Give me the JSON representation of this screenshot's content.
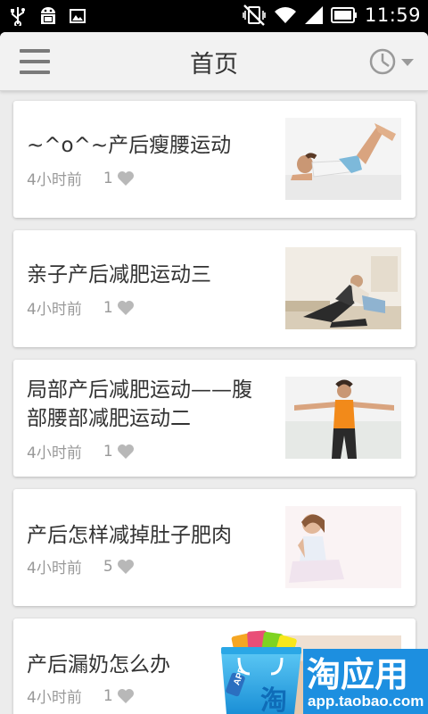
{
  "status_bar": {
    "time": "11:59",
    "left_icons": [
      "usb-icon",
      "android-debug-icon",
      "image-icon"
    ],
    "right_icons": [
      "vibrate-off-icon",
      "wifi-icon",
      "signal-icon",
      "battery-icon"
    ]
  },
  "app_bar": {
    "title": "首页",
    "menu_icon": "hamburger-menu-icon",
    "history_icon": "clock-dropdown-icon"
  },
  "articles": [
    {
      "title": "~^o^~产后瘦腰运动",
      "time": "4小时前",
      "likes": "1",
      "image": "woman-lying-leg-raise"
    },
    {
      "title": "亲子产后减肥运动三",
      "time": "4小时前",
      "likes": "1",
      "image": "mother-child-exercise"
    },
    {
      "title": "局部产后减肥运动——腹部腰部减肥运动二",
      "time": "4小时前",
      "likes": "1",
      "image": "woman-arms-stretch"
    },
    {
      "title": "产后怎样减掉肚子肥肉",
      "time": "4小时前",
      "likes": "5",
      "image": "woman-sitting-yoga"
    },
    {
      "title": "产后漏奶怎么办",
      "time": "4小时前",
      "likes": "1",
      "image": "mother-with-baby"
    }
  ],
  "promo": {
    "name": "淘应用",
    "url": "app.taobao.com",
    "badge": "APP",
    "glyph": "淘",
    "colors": {
      "blue": "#1d8fe0",
      "bag": "#38b6f0"
    }
  },
  "colors": {
    "heart": "#b8b8b8",
    "meta": "#999999",
    "title": "#333333",
    "appbar": "#f2f2f2"
  }
}
